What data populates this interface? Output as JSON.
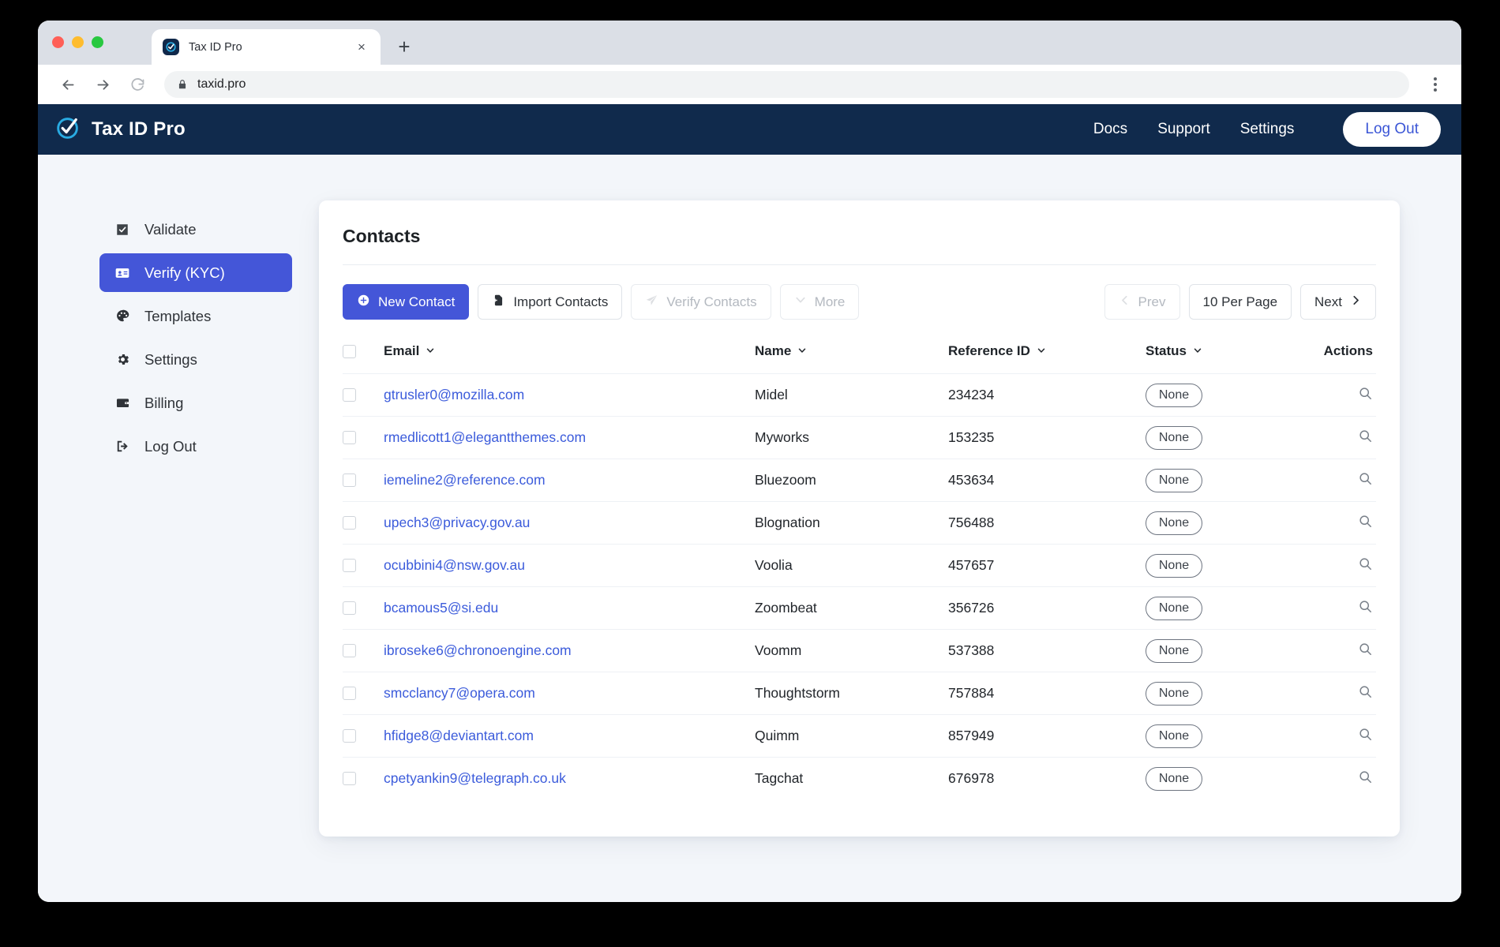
{
  "browser": {
    "tab_title": "Tax ID Pro",
    "favicon_name": "taxid-favicon",
    "close_label": "×",
    "newtab_label": "+",
    "url": "taxid.pro",
    "back_label": "←",
    "forward_label": "→",
    "reload_label": "↻",
    "menu_name": "kebab-menu-icon"
  },
  "appbar": {
    "brand": "Tax ID Pro",
    "nav": [
      {
        "label": "Docs"
      },
      {
        "label": "Support"
      },
      {
        "label": "Settings"
      }
    ],
    "logout_label": "Log Out"
  },
  "sidebar": {
    "items": [
      {
        "label": "Validate",
        "icon": "checkbox-icon",
        "active": false
      },
      {
        "label": "Verify (KYC)",
        "icon": "id-card-icon",
        "active": true
      },
      {
        "label": "Templates",
        "icon": "palette-icon",
        "active": false
      },
      {
        "label": "Settings",
        "icon": "gear-icon",
        "active": false
      },
      {
        "label": "Billing",
        "icon": "wallet-icon",
        "active": false
      },
      {
        "label": "Log Out",
        "icon": "sign-out-icon",
        "active": false
      }
    ]
  },
  "main": {
    "title": "Contacts",
    "toolbar": {
      "new_contact": "New Contact",
      "import_contacts": "Import Contacts",
      "verify_contacts": "Verify Contacts",
      "more": "More"
    },
    "pagination": {
      "prev": "Prev",
      "per_page": "10 Per Page",
      "next": "Next"
    },
    "table": {
      "columns": [
        "Email",
        "Name",
        "Reference ID",
        "Status",
        "Actions"
      ],
      "rows": [
        {
          "email": "gtrusler0@mozilla.com",
          "name": "Midel",
          "reference_id": "234234",
          "status": "None"
        },
        {
          "email": "rmedlicott1@elegantthemes.com",
          "name": "Myworks",
          "reference_id": "153235",
          "status": "None"
        },
        {
          "email": "iemeline2@reference.com",
          "name": "Bluezoom",
          "reference_id": "453634",
          "status": "None"
        },
        {
          "email": "upech3@privacy.gov.au",
          "name": "Blognation",
          "reference_id": "756488",
          "status": "None"
        },
        {
          "email": "ocubbini4@nsw.gov.au",
          "name": "Voolia",
          "reference_id": "457657",
          "status": "None"
        },
        {
          "email": "bcamous5@si.edu",
          "name": "Zoombeat",
          "reference_id": "356726",
          "status": "None"
        },
        {
          "email": "ibroseke6@chronoengine.com",
          "name": "Voomm",
          "reference_id": "537388",
          "status": "None"
        },
        {
          "email": "smcclancy7@opera.com",
          "name": "Thoughtstorm",
          "reference_id": "757884",
          "status": "None"
        },
        {
          "email": "hfidge8@deviantart.com",
          "name": "Quimm",
          "reference_id": "857949",
          "status": "None"
        },
        {
          "email": "cpetyankin9@telegraph.co.uk",
          "name": "Tagchat",
          "reference_id": "676978",
          "status": "None"
        }
      ]
    }
  },
  "colors": {
    "appbar": "#102a4c",
    "accent": "#4456d8",
    "link": "#3b5bdb",
    "logo_ring": "#29abe2",
    "page_bg": "#f3f6fa"
  }
}
